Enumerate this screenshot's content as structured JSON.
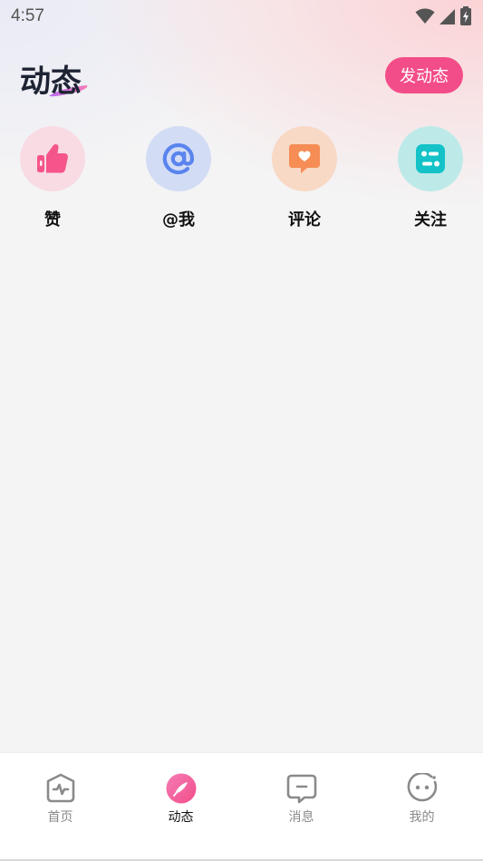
{
  "status_bar": {
    "time": "4:57",
    "icons": [
      "wifi-icon",
      "cellular-signal-icon",
      "battery-charging-icon"
    ]
  },
  "header": {
    "title": "动态",
    "post_button_label": "发动态",
    "accent_color": "#f24d89"
  },
  "quick_actions": [
    {
      "label": "赞",
      "icon": "thumbs-up-icon",
      "circle_color": "#f9dbe4",
      "icon_color": "#f5558a"
    },
    {
      "label": "@我",
      "icon": "at-sign-icon",
      "circle_color": "#d3dcf5",
      "icon_color": "#5a84ee"
    },
    {
      "label": "评论",
      "icon": "comment-heart-icon",
      "circle_color": "#f8d9c6",
      "icon_color": "#f58d55"
    },
    {
      "label": "关注",
      "icon": "follow-list-icon",
      "circle_color": "#bdeae9",
      "icon_color": "#14c2c8"
    }
  ],
  "bottom_nav": {
    "items": [
      {
        "label": "首页",
        "icon": "home-pulse-icon",
        "active": false
      },
      {
        "label": "动态",
        "icon": "feather-icon",
        "active": true
      },
      {
        "label": "消息",
        "icon": "message-icon",
        "active": false
      },
      {
        "label": "我的",
        "icon": "smiley-profile-icon",
        "active": false
      }
    ]
  }
}
